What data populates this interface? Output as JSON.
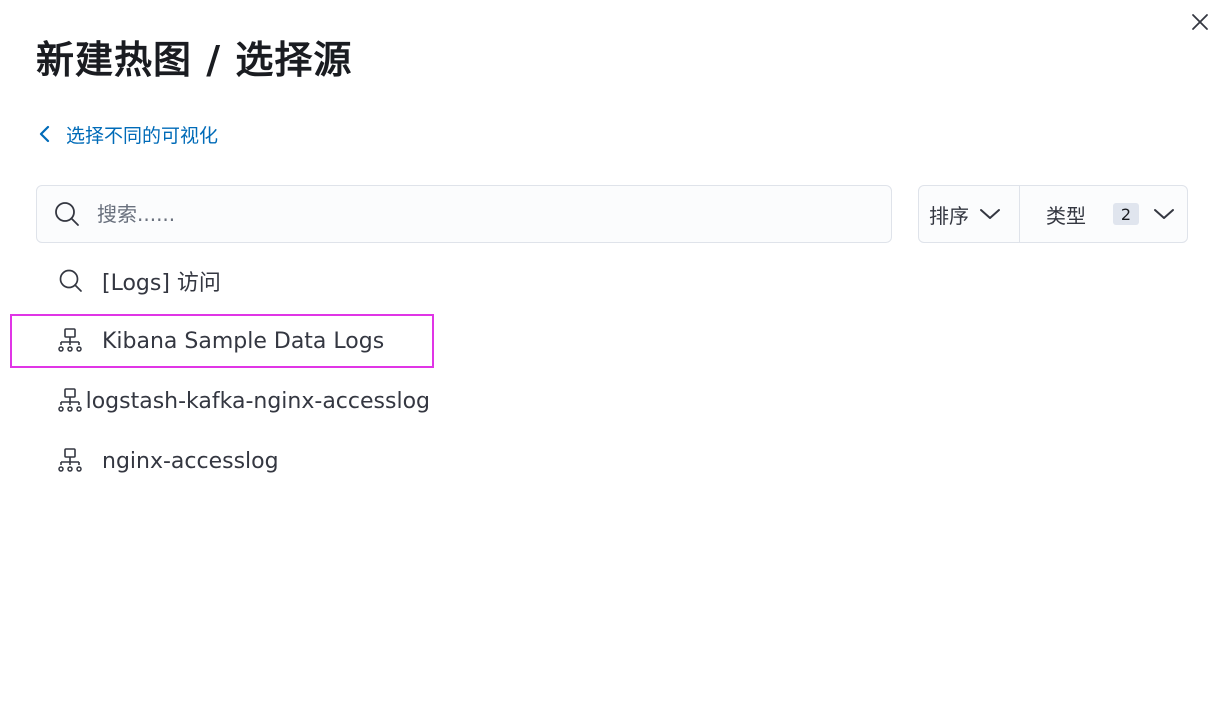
{
  "dialog": {
    "title": "新建热图 / 选择源",
    "close_icon": "close-icon"
  },
  "back_link": {
    "label": "选择不同的可视化",
    "icon": "chevron-left-icon"
  },
  "search": {
    "placeholder": "搜索......",
    "value": "",
    "icon": "search-icon"
  },
  "filters": {
    "sort_label": "排序",
    "type_label": "类型",
    "type_count": "2"
  },
  "results": [
    {
      "label": "[Logs] 访问",
      "icon": "saved-search-icon"
    },
    {
      "label": "Kibana Sample Data Logs",
      "icon": "index-pattern-icon"
    },
    {
      "label": "logstash-kafka-nginx-accesslog",
      "icon": "index-pattern-icon"
    },
    {
      "label": "nginx-accesslog",
      "icon": "index-pattern-icon"
    }
  ],
  "colors": {
    "link": "#006bb8",
    "highlight_outline": "#e035e6",
    "border": "#dfe3ea"
  }
}
